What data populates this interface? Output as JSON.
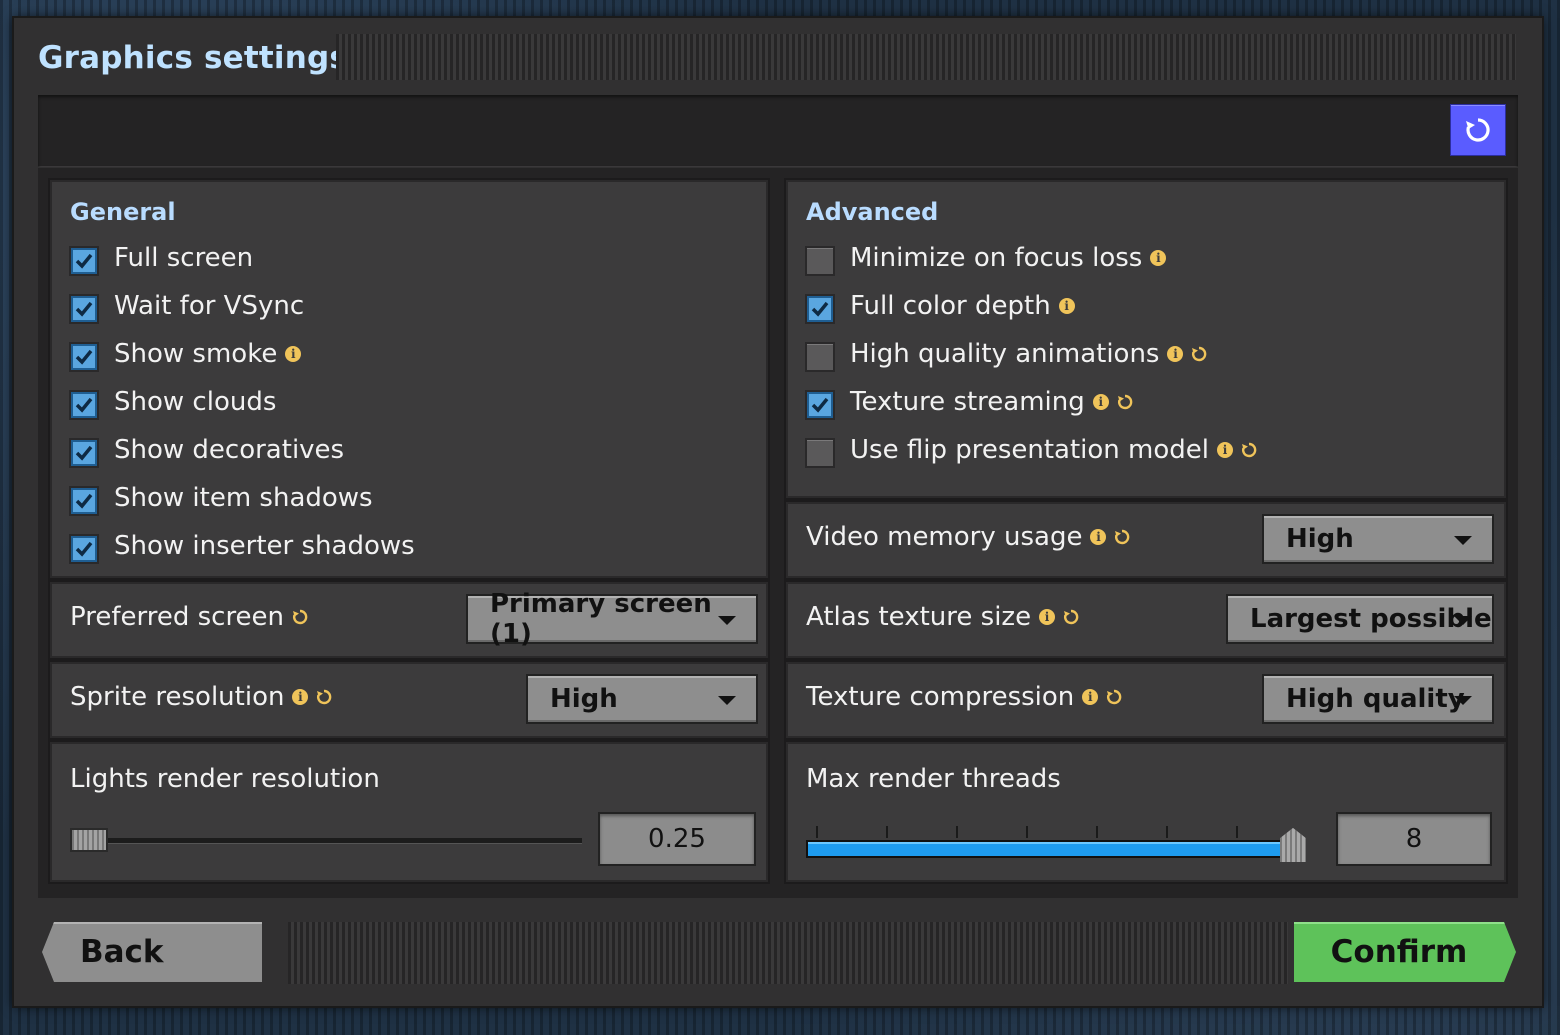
{
  "window": {
    "title": "Graphics settings"
  },
  "toolbar": {
    "reset_icon": "reset-defaults-icon",
    "reset_color": "#5a5cff"
  },
  "general": {
    "heading": "General",
    "checkboxes": [
      {
        "label": "Full screen",
        "checked": true,
        "info": false
      },
      {
        "label": "Wait for VSync",
        "checked": true,
        "info": false
      },
      {
        "label": "Show smoke",
        "checked": true,
        "info": true
      },
      {
        "label": "Show clouds",
        "checked": true,
        "info": false
      },
      {
        "label": "Show decoratives",
        "checked": true,
        "info": false
      },
      {
        "label": "Show item shadows",
        "checked": true,
        "info": false
      },
      {
        "label": "Show inserter shadows",
        "checked": true,
        "info": false
      }
    ],
    "preferred_screen": {
      "label": "Preferred screen",
      "value": "Primary screen (1)"
    },
    "sprite_resolution": {
      "label": "Sprite resolution",
      "value": "High"
    },
    "lights_render_resolution": {
      "label": "Lights render resolution",
      "value": "0.25",
      "slider_fraction": 0.0
    }
  },
  "advanced": {
    "heading": "Advanced",
    "checkboxes": [
      {
        "label": "Minimize on focus loss",
        "checked": false,
        "info": true,
        "restart": false
      },
      {
        "label": "Full color depth",
        "checked": true,
        "info": true,
        "restart": false
      },
      {
        "label": "High quality animations",
        "checked": false,
        "info": true,
        "restart": true
      },
      {
        "label": "Texture streaming",
        "checked": true,
        "info": true,
        "restart": true
      },
      {
        "label": "Use flip presentation model",
        "checked": false,
        "info": true,
        "restart": true
      }
    ],
    "video_memory_usage": {
      "label": "Video memory usage",
      "value": "High"
    },
    "atlas_texture_size": {
      "label": "Atlas texture size",
      "value": "Largest possible"
    },
    "texture_compression": {
      "label": "Texture compression",
      "value": "High quality"
    },
    "max_render_threads": {
      "label": "Max render threads",
      "value": "8",
      "slider_fraction": 1.0
    }
  },
  "footer": {
    "back_label": "Back",
    "confirm_label": "Confirm",
    "confirm_color": "#5ec25a"
  },
  "colors": {
    "heading": "#b9dcff",
    "info_icon": "#f0c45a",
    "checkbox_checked": "#5aa6e0",
    "slider_fill": "#1e9cf0"
  }
}
